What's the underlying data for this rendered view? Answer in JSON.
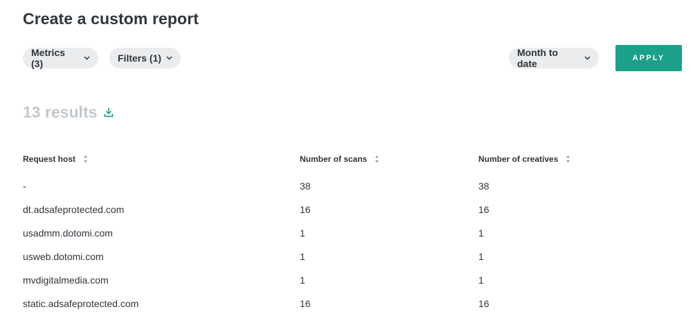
{
  "page": {
    "title": "Create a custom report"
  },
  "toolbar": {
    "metrics_label": "Metrics (3)",
    "filters_label": "Filters (1)",
    "date_range_label": "Month to date",
    "apply_label": "APPLY"
  },
  "results": {
    "count_label": "13 results"
  },
  "table": {
    "columns": [
      "Request host",
      "Number of scans",
      "Number of creatives"
    ],
    "rows": [
      {
        "host": "-",
        "scans": "38",
        "creatives": "38"
      },
      {
        "host": "dt.adsafeprotected.com",
        "scans": "16",
        "creatives": "16"
      },
      {
        "host": "usadmm.dotomi.com",
        "scans": "1",
        "creatives": "1"
      },
      {
        "host": "usweb.dotomi.com",
        "scans": "1",
        "creatives": "1"
      },
      {
        "host": "mvdigitalmedia.com",
        "scans": "1",
        "creatives": "1"
      },
      {
        "host": "static.adsafeprotected.com",
        "scans": "16",
        "creatives": "16"
      }
    ]
  },
  "icons": {
    "chevron": "chevron-down-icon",
    "download": "download-icon",
    "sort": "sort-icon"
  },
  "colors": {
    "accent": "#1aa189",
    "pill_bg": "#ebeced",
    "muted_text": "#c3c8cc",
    "text": "#2e353b"
  }
}
